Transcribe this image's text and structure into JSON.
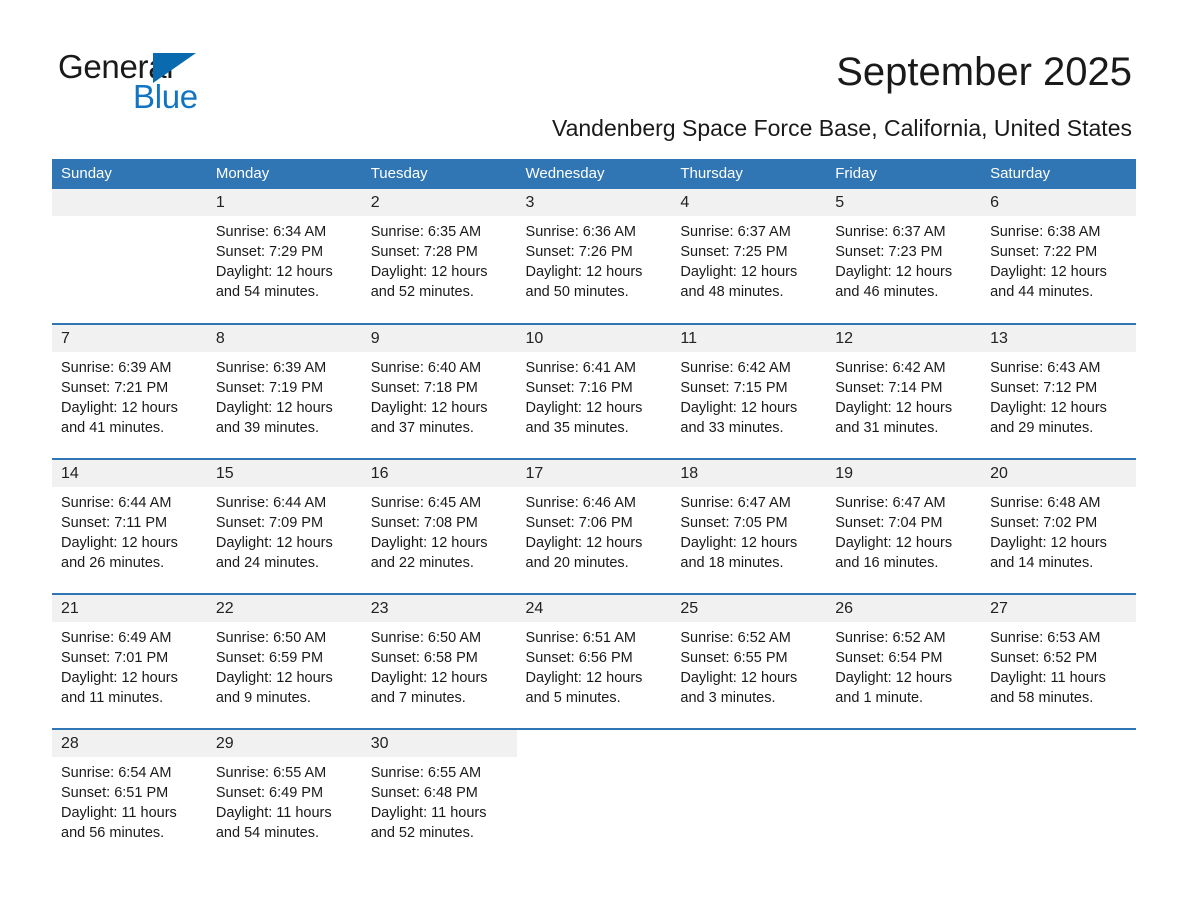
{
  "brand": {
    "line1": "General",
    "line2": "Blue",
    "triangle_color": "#0a6ab0",
    "accent_color": "#1175c4"
  },
  "header": {
    "title": "September 2025",
    "location": "Vandenberg Space Force Base, California, United States"
  },
  "theme": {
    "header_blue": "#3075b4",
    "daynum_band": "#f1f1f1",
    "text": "#1a1a1a"
  },
  "weekday_headers": [
    "Sunday",
    "Monday",
    "Tuesday",
    "Wednesday",
    "Thursday",
    "Friday",
    "Saturday"
  ],
  "weeks": [
    [
      {
        "day": "",
        "lines": []
      },
      {
        "day": "1",
        "lines": [
          "Sunrise: 6:34 AM",
          "Sunset: 7:29 PM",
          "Daylight: 12 hours and 54 minutes."
        ]
      },
      {
        "day": "2",
        "lines": [
          "Sunrise: 6:35 AM",
          "Sunset: 7:28 PM",
          "Daylight: 12 hours and 52 minutes."
        ]
      },
      {
        "day": "3",
        "lines": [
          "Sunrise: 6:36 AM",
          "Sunset: 7:26 PM",
          "Daylight: 12 hours and 50 minutes."
        ]
      },
      {
        "day": "4",
        "lines": [
          "Sunrise: 6:37 AM",
          "Sunset: 7:25 PM",
          "Daylight: 12 hours and 48 minutes."
        ]
      },
      {
        "day": "5",
        "lines": [
          "Sunrise: 6:37 AM",
          "Sunset: 7:23 PM",
          "Daylight: 12 hours and 46 minutes."
        ]
      },
      {
        "day": "6",
        "lines": [
          "Sunrise: 6:38 AM",
          "Sunset: 7:22 PM",
          "Daylight: 12 hours and 44 minutes."
        ]
      }
    ],
    [
      {
        "day": "7",
        "lines": [
          "Sunrise: 6:39 AM",
          "Sunset: 7:21 PM",
          "Daylight: 12 hours and 41 minutes."
        ]
      },
      {
        "day": "8",
        "lines": [
          "Sunrise: 6:39 AM",
          "Sunset: 7:19 PM",
          "Daylight: 12 hours and 39 minutes."
        ]
      },
      {
        "day": "9",
        "lines": [
          "Sunrise: 6:40 AM",
          "Sunset: 7:18 PM",
          "Daylight: 12 hours and 37 minutes."
        ]
      },
      {
        "day": "10",
        "lines": [
          "Sunrise: 6:41 AM",
          "Sunset: 7:16 PM",
          "Daylight: 12 hours and 35 minutes."
        ]
      },
      {
        "day": "11",
        "lines": [
          "Sunrise: 6:42 AM",
          "Sunset: 7:15 PM",
          "Daylight: 12 hours and 33 minutes."
        ]
      },
      {
        "day": "12",
        "lines": [
          "Sunrise: 6:42 AM",
          "Sunset: 7:14 PM",
          "Daylight: 12 hours and 31 minutes."
        ]
      },
      {
        "day": "13",
        "lines": [
          "Sunrise: 6:43 AM",
          "Sunset: 7:12 PM",
          "Daylight: 12 hours and 29 minutes."
        ]
      }
    ],
    [
      {
        "day": "14",
        "lines": [
          "Sunrise: 6:44 AM",
          "Sunset: 7:11 PM",
          "Daylight: 12 hours and 26 minutes."
        ]
      },
      {
        "day": "15",
        "lines": [
          "Sunrise: 6:44 AM",
          "Sunset: 7:09 PM",
          "Daylight: 12 hours and 24 minutes."
        ]
      },
      {
        "day": "16",
        "lines": [
          "Sunrise: 6:45 AM",
          "Sunset: 7:08 PM",
          "Daylight: 12 hours and 22 minutes."
        ]
      },
      {
        "day": "17",
        "lines": [
          "Sunrise: 6:46 AM",
          "Sunset: 7:06 PM",
          "Daylight: 12 hours and 20 minutes."
        ]
      },
      {
        "day": "18",
        "lines": [
          "Sunrise: 6:47 AM",
          "Sunset: 7:05 PM",
          "Daylight: 12 hours and 18 minutes."
        ]
      },
      {
        "day": "19",
        "lines": [
          "Sunrise: 6:47 AM",
          "Sunset: 7:04 PM",
          "Daylight: 12 hours and 16 minutes."
        ]
      },
      {
        "day": "20",
        "lines": [
          "Sunrise: 6:48 AM",
          "Sunset: 7:02 PM",
          "Daylight: 12 hours and 14 minutes."
        ]
      }
    ],
    [
      {
        "day": "21",
        "lines": [
          "Sunrise: 6:49 AM",
          "Sunset: 7:01 PM",
          "Daylight: 12 hours and 11 minutes."
        ]
      },
      {
        "day": "22",
        "lines": [
          "Sunrise: 6:50 AM",
          "Sunset: 6:59 PM",
          "Daylight: 12 hours and 9 minutes."
        ]
      },
      {
        "day": "23",
        "lines": [
          "Sunrise: 6:50 AM",
          "Sunset: 6:58 PM",
          "Daylight: 12 hours and 7 minutes."
        ]
      },
      {
        "day": "24",
        "lines": [
          "Sunrise: 6:51 AM",
          "Sunset: 6:56 PM",
          "Daylight: 12 hours and 5 minutes."
        ]
      },
      {
        "day": "25",
        "lines": [
          "Sunrise: 6:52 AM",
          "Sunset: 6:55 PM",
          "Daylight: 12 hours and 3 minutes."
        ]
      },
      {
        "day": "26",
        "lines": [
          "Sunrise: 6:52 AM",
          "Sunset: 6:54 PM",
          "Daylight: 12 hours and 1 minute."
        ]
      },
      {
        "day": "27",
        "lines": [
          "Sunrise: 6:53 AM",
          "Sunset: 6:52 PM",
          "Daylight: 11 hours and 58 minutes."
        ]
      }
    ],
    [
      {
        "day": "28",
        "lines": [
          "Sunrise: 6:54 AM",
          "Sunset: 6:51 PM",
          "Daylight: 11 hours and 56 minutes."
        ]
      },
      {
        "day": "29",
        "lines": [
          "Sunrise: 6:55 AM",
          "Sunset: 6:49 PM",
          "Daylight: 11 hours and 54 minutes."
        ]
      },
      {
        "day": "30",
        "lines": [
          "Sunrise: 6:55 AM",
          "Sunset: 6:48 PM",
          "Daylight: 11 hours and 52 minutes."
        ]
      },
      {
        "day": "",
        "lines": []
      },
      {
        "day": "",
        "lines": []
      },
      {
        "day": "",
        "lines": []
      },
      {
        "day": "",
        "lines": []
      }
    ]
  ]
}
